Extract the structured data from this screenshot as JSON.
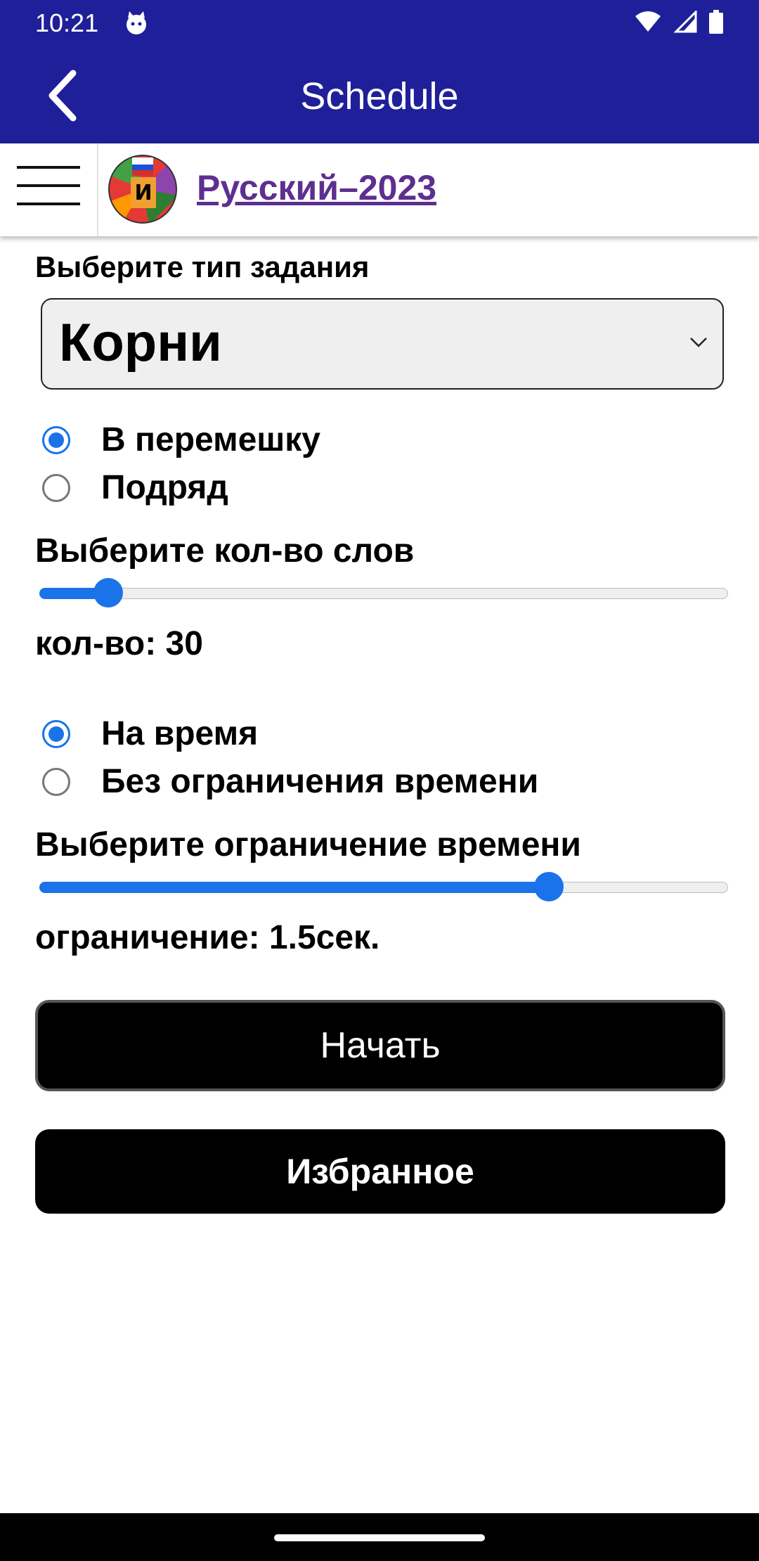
{
  "status_bar": {
    "time": "10:21"
  },
  "app_bar": {
    "title": "Schedule"
  },
  "header": {
    "site_title": "Русский–2023"
  },
  "task_type": {
    "label": "Выберите тип задания",
    "selected": "Корни"
  },
  "order_options": [
    {
      "label": "В перемешку",
      "checked": true
    },
    {
      "label": "Подряд",
      "checked": false
    }
  ],
  "words_count": {
    "label": "Выберите кол-во слов",
    "slider_fraction": 0.1,
    "value_text": "кол-во: 30"
  },
  "time_options": [
    {
      "label": "На время",
      "checked": true
    },
    {
      "label": "Без ограничения времени",
      "checked": false
    }
  ],
  "time_limit": {
    "label": "Выберите ограничение времени",
    "slider_fraction": 0.74,
    "value_text": "ограничение: 1.5сек."
  },
  "buttons": {
    "start": "Начать",
    "favorites": "Избранное"
  },
  "colors": {
    "app_bar": "#1f1f9a",
    "accent": "#1a73e8",
    "link": "#5e2f8f"
  }
}
